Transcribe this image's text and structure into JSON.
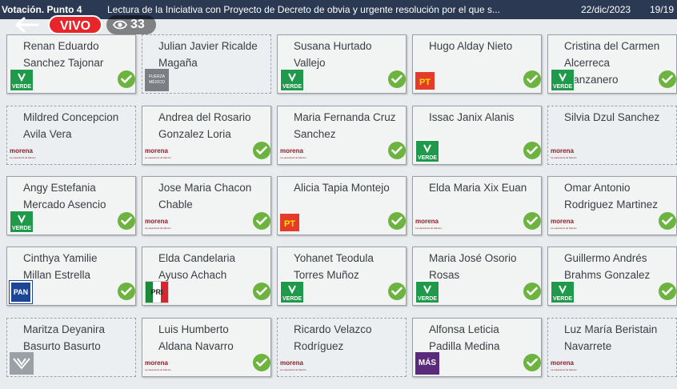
{
  "header": {
    "vote_label": "Votación. Punto 4",
    "title": "Lectura de la Iniciativa con Proyecto de Decreto de obvia y urgente resolución por el que s...",
    "date": "22/dic/2023",
    "count": "19/19"
  },
  "stream": {
    "live_label": "VIVO",
    "viewers": "33"
  },
  "party_labels": {
    "verde": "VERDE",
    "pt": "PT",
    "morena": "morena",
    "morena_tag": "La esperanza de México",
    "fm": "FUERZA MÉXICO",
    "pan": "PAN",
    "pri": "PRI",
    "mas": "MÁS"
  },
  "legislators": [
    {
      "line1": "Renan Eduardo",
      "line2": "Sanchez Tajonar",
      "party": "verde",
      "voted": true
    },
    {
      "line1": "Julian Javier Ricalde",
      "line2": "Magaña",
      "party": "fm",
      "voted": false
    },
    {
      "line1": "Susana Hurtado",
      "line2": "Vallejo",
      "party": "verde",
      "voted": true
    },
    {
      "line1": "Hugo Alday Nieto",
      "line2": "",
      "party": "pt",
      "voted": true
    },
    {
      "line1": "Cristina del Carmen",
      "line2": "Alcerreca",
      "line3": "Manzanero",
      "party": "verde",
      "voted": true
    },
    {
      "line1": "Mildred Concepcion",
      "line2": "Avila Vera",
      "party": "morena",
      "voted": false
    },
    {
      "line1": "Andrea del Rosario",
      "line2": "Gonzalez Loria",
      "party": "morena",
      "voted": true
    },
    {
      "line1": "Maria Fernanda Cruz",
      "line2": "Sanchez",
      "party": "morena",
      "voted": true
    },
    {
      "line1": "Issac Janix Alanis",
      "line2": "",
      "party": "verde",
      "voted": true
    },
    {
      "line1": "Silvia Dzul Sanchez",
      "line2": "",
      "party": "morena",
      "voted": false
    },
    {
      "line1": "Angy Estefania",
      "line2": "Mercado Asencio",
      "party": "verde",
      "voted": true
    },
    {
      "line1": "Jose Maria Chacon",
      "line2": "Chable",
      "party": "morena",
      "voted": true
    },
    {
      "line1": "Alicia Tapia Montejo",
      "line2": "",
      "party": "pt",
      "voted": true
    },
    {
      "line1": "Elda Maria Xix Euan",
      "line2": "",
      "party": "morena",
      "voted": true
    },
    {
      "line1": "Omar Antonio",
      "line2": "Rodriguez Martinez",
      "party": "morena",
      "voted": true
    },
    {
      "line1": "Cinthya Yamilie",
      "line2": "Millan Estrella",
      "party": "pan",
      "voted": true
    },
    {
      "line1": "Elda Candelaria",
      "line2": "Ayuso Achach",
      "party": "pri",
      "voted": true
    },
    {
      "line1": "Yohanet Teodula",
      "line2": "Torres Muñoz",
      "party": "verde",
      "voted": true
    },
    {
      "line1": "Maria José Osorio",
      "line2": "Rosas",
      "party": "verde",
      "voted": true
    },
    {
      "line1": "Guillermo Andrés",
      "line2": "Brahms Gonzalez",
      "party": "verde",
      "voted": true
    },
    {
      "line1": "Maritza Deyanira",
      "line2": "Basurto Basurto",
      "party": "mc",
      "voted": false
    },
    {
      "line1": "Luis Humberto",
      "line2": "Aldana Navarro",
      "party": "morena",
      "voted": true
    },
    {
      "line1": "Ricardo Velazco",
      "line2": "Rodríguez",
      "party": "morena",
      "voted": false
    },
    {
      "line1": "Alfonsa Leticia",
      "line2": "Padilla Medina",
      "party": "mas",
      "voted": true
    },
    {
      "line1": "Luz María Beristain",
      "line2": "Navarrete",
      "party": "morena",
      "voted": false
    }
  ],
  "colors": {
    "header_bg": "#2b3a52",
    "live_red": "#e8252b",
    "check_green": "#6cb33f",
    "verde": "#1f9a4a",
    "morena": "#8b1f2a",
    "pan": "#1c4596"
  }
}
